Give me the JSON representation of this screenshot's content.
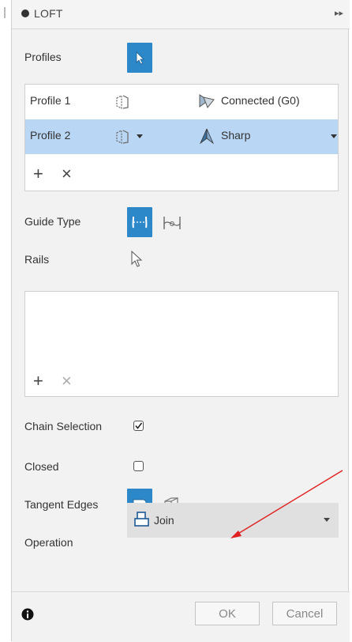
{
  "window": {
    "title": "LOFT"
  },
  "profiles": {
    "label": "Profiles",
    "rows": [
      {
        "name": "Profile 1",
        "continuity": "Connected (G0)"
      },
      {
        "name": "Profile 2",
        "continuity": "Sharp"
      }
    ]
  },
  "guide_type": {
    "label": "Guide Type"
  },
  "rails": {
    "label": "Rails"
  },
  "chain_selection": {
    "label": "Chain Selection",
    "checked": true
  },
  "closed": {
    "label": "Closed",
    "checked": false
  },
  "tangent_edges": {
    "label": "Tangent Edges"
  },
  "operation": {
    "label": "Operation",
    "value": "Join"
  },
  "footer": {
    "ok_label": "OK",
    "cancel_label": "Cancel"
  },
  "colors": {
    "accent": "#2c88c9",
    "selected_row": "#b9d6f4",
    "annotation_arrow": "#e02020"
  }
}
